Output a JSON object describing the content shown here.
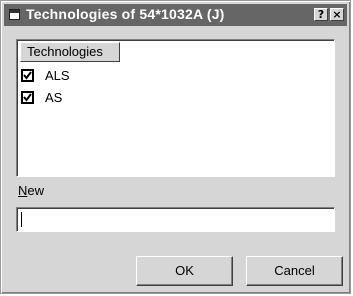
{
  "window": {
    "title": "Technologies of 54*1032A (J)",
    "help_button": "?",
    "close_button": "×"
  },
  "list": {
    "column_header": "Technologies",
    "items": [
      {
        "label": "ALS",
        "checked": true
      },
      {
        "label": "AS",
        "checked": true
      }
    ]
  },
  "new_field": {
    "label_accel": "N",
    "label_rest": "ew",
    "value": ""
  },
  "buttons": {
    "ok": "OK",
    "cancel": "Cancel"
  }
}
